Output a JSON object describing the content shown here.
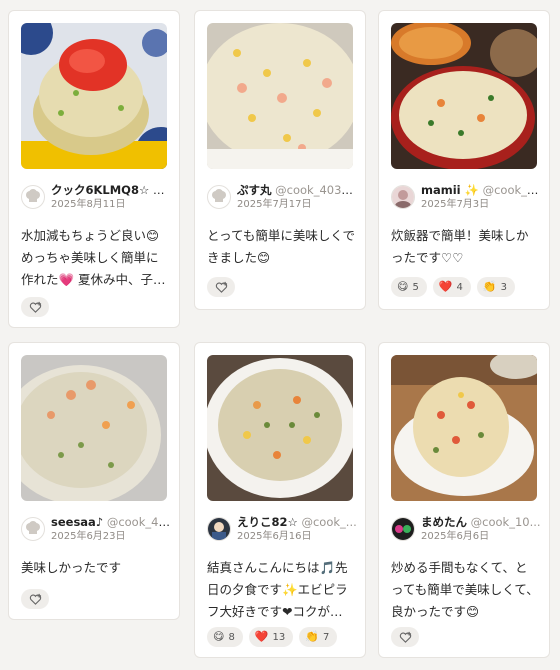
{
  "cards": [
    {
      "user_name": "クック6KLMQ8☆",
      "user_handle": "@...",
      "date": "2025年8月11日",
      "comment": "水加減もちょうど良い😊めっちゃ美味しく簡単に作れた💗 夏休み中、子…",
      "photo_icon": "fried-rice-photo"
    },
    {
      "user_name": "ぷす丸",
      "user_handle": "@cook_4034...",
      "date": "2025年7月17日",
      "comment": "とっても簡単に美味しくできました😊",
      "photo_icon": "fried-rice-photo"
    },
    {
      "user_name": "mamii ✨",
      "user_handle": "@cook_4...",
      "date": "2025年7月3日",
      "comment": "炊飯器で簡単！美味しかったです♡♡",
      "photo_icon": "fried-rice-photo",
      "reactions": [
        {
          "emoji": "😋",
          "count": "5"
        },
        {
          "emoji": "❤️",
          "count": "4"
        },
        {
          "emoji": "👏",
          "count": "3"
        }
      ]
    },
    {
      "user_name": "seesaa♪",
      "user_handle": "@cook_408...",
      "date": "2025年6月23日",
      "comment": "美味しかったです",
      "photo_icon": "fried-rice-photo"
    },
    {
      "user_name": "えりこ82☆",
      "user_handle": "@cook_...",
      "date": "2025年6月16日",
      "comment": "結真さんこんにちは🎵先日の夕食です✨エビピラフ大好きです❤コクが…",
      "photo_icon": "fried-rice-photo",
      "reactions": [
        {
          "emoji": "😋",
          "count": "8"
        },
        {
          "emoji": "❤️",
          "count": "13"
        },
        {
          "emoji": "👏",
          "count": "7"
        }
      ]
    },
    {
      "user_name": "まめたん",
      "user_handle": "@cook_10...",
      "date": "2025年6月6日",
      "comment": "炒める手間もなくて、とっても簡単で美味しくて、良かったです😊",
      "photo_icon": "fried-rice-photo"
    }
  ],
  "icons": {
    "add_reaction": "heart-plus-icon",
    "default_avatar": "chef-hat-icon"
  },
  "colors": {
    "page_bg": "#f4f3f1",
    "card_bg": "#ffffff",
    "pill_bg": "#efedea",
    "muted_text": "#8f8a85"
  }
}
